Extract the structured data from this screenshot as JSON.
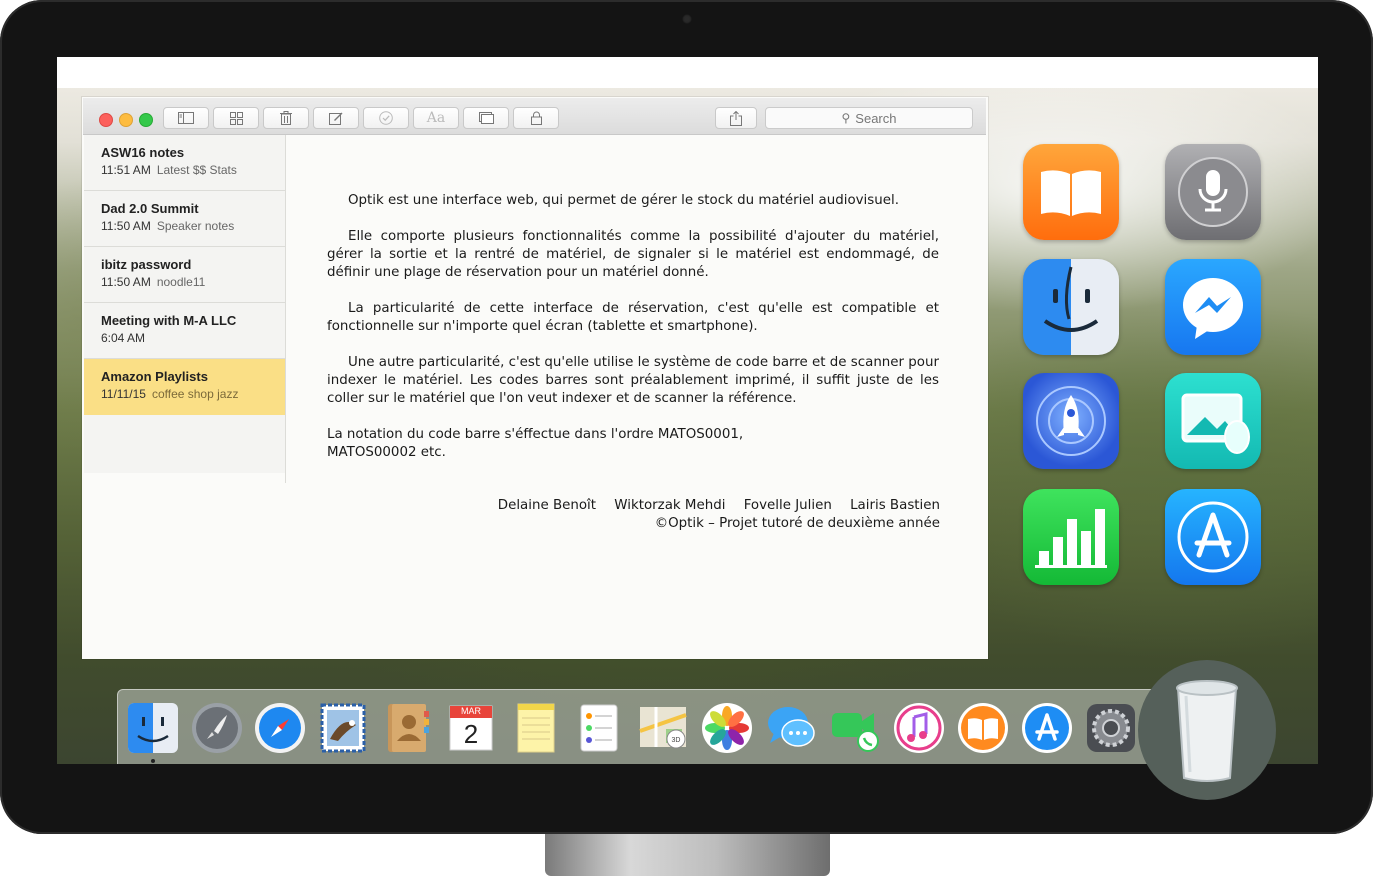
{
  "notes_window": {
    "search_placeholder": "Search",
    "toolbar_buttons": [
      "sidebar-toggle",
      "gallery-view",
      "delete-note",
      "new-note",
      "checklist",
      "format-text",
      "attachments",
      "lock-note",
      "share"
    ],
    "notes": [
      {
        "title": "ASW16 notes",
        "time": "11:51 AM",
        "preview": "Latest $$ Stats",
        "selected": false
      },
      {
        "title": "Dad 2.0 Summit",
        "time": "11:50 AM",
        "preview": "Speaker notes",
        "selected": false
      },
      {
        "title": "ibitz password",
        "time": "11:50 AM",
        "preview": "noodle11",
        "selected": false
      },
      {
        "title": "Meeting with M-A LLC",
        "time": "6:04 AM",
        "preview": "",
        "selected": false
      },
      {
        "title": "Amazon Playlists",
        "time": "11/11/15",
        "preview": "coffee shop jazz",
        "selected": true
      }
    ]
  },
  "content": {
    "p1": "Optik est une interface web, qui permet de gérer le stock du matériel audiovisuel.",
    "p2": "Elle comporte plusieurs fonctionnalités comme la possibilité d'ajouter du matériel, gérer la sortie et la rentré de matériel, de signaler si le matériel est endommagé, de définir une plage de réservation pour un matériel donné.",
    "p3": "La particularité de cette interface de réservation, c'est qu'elle est compatible et fonctionnelle sur n'importe quel écran (tablette et smartphone).",
    "p4": "Une autre particularité, c'est qu'elle utilise le système de code barre et de scanner pour indexer le matériel. Les codes barres sont préalablement imprimé, il suffit juste de les coller sur le matériel que l'on veut indexer et de scanner la référence.",
    "p5_line1": "La notation du code barre s'éffectue dans l'ordre MATOS0001,",
    "p5_line2": "MATOS00002 etc.",
    "authors": [
      "Delaine Benoît",
      "Wiktorzak Mehdi",
      "Fovelle Julien",
      "Lairis Bastien"
    ],
    "copyright": "©Optik – Projet tutoré de deuxième année"
  },
  "desktop_apps": [
    "ibooks-icon",
    "siri-icon",
    "finder-icon",
    "messenger-icon",
    "launchpad-icon",
    "preview-icon",
    "numbers-icon",
    "app-store-icon"
  ],
  "dock": {
    "calendar_month": "MAR",
    "calendar_day": "2",
    "items": [
      "finder",
      "launchpad",
      "safari",
      "mail",
      "contacts",
      "calendar",
      "notes",
      "reminders",
      "maps",
      "photos",
      "messages",
      "facetime",
      "itunes",
      "ibooks",
      "app-store",
      "system-preferences",
      "trash"
    ]
  },
  "colors": {
    "selected_note": "#fadf86",
    "close": "#fc605c",
    "minimize": "#fdbc40",
    "zoom": "#34c84a"
  }
}
